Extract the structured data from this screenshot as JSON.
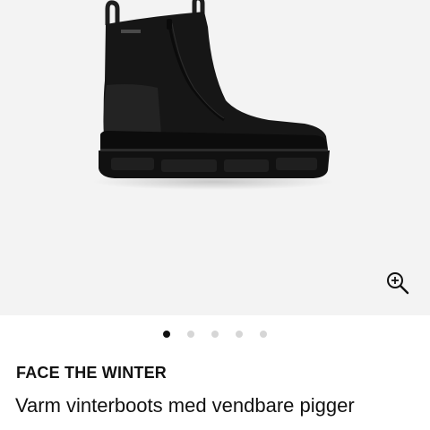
{
  "gallery": {
    "image_alt": "Black suede winter boot",
    "zoom_icon": "zoom-in-icon",
    "total_images": 5,
    "active_index": 0
  },
  "product": {
    "brand": "FACE THE WINTER",
    "title": "Varm vinterboots med vendbare pigger"
  },
  "colors": {
    "gallery_bg": "#f3f3f3",
    "dot_active": "#111111",
    "dot_inactive": "#d6d6d6",
    "text": "#111111"
  }
}
